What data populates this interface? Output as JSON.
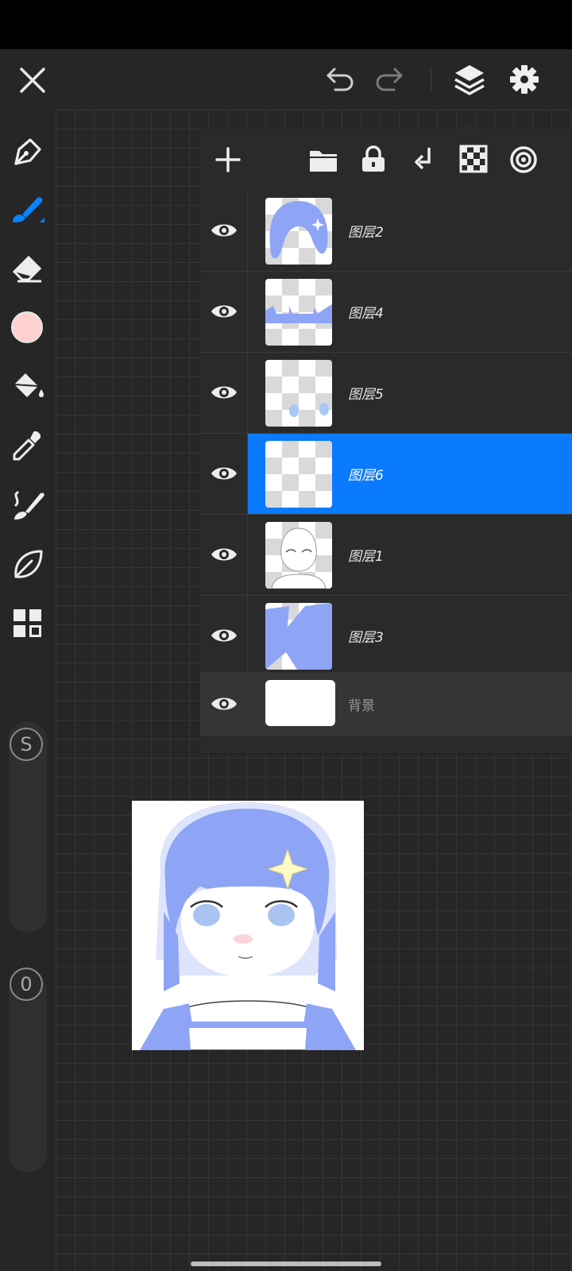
{
  "top_bar": {
    "icons": [
      "close-icon",
      "undo-icon",
      "redo-icon",
      "layers-icon",
      "settings-icon"
    ]
  },
  "toolbar": {
    "tools": [
      "pen-tool-icon",
      "brush-tool-icon",
      "eraser-tool-icon",
      "color-swatch",
      "fill-bucket-icon",
      "eyedropper-icon",
      "smudge-brush-icon",
      "leaf-icon",
      "grid-apps-icon"
    ],
    "current_color": "#ffd0d0",
    "active_color": "#0a84ff",
    "size_label": "S",
    "opacity_label": "0"
  },
  "layer_panel": {
    "toolbar_icons": [
      "add-layer-icon",
      "folder-icon",
      "lock-icon",
      "merge-down-icon",
      "checker-icon",
      "spiral-icon"
    ],
    "layers": [
      {
        "name": "图层2",
        "selected": false
      },
      {
        "name": "图层4",
        "selected": false
      },
      {
        "name": "图层5",
        "selected": false
      },
      {
        "name": "图层6",
        "selected": true
      },
      {
        "name": "图层1",
        "selected": false
      },
      {
        "name": "图层3",
        "selected": false
      }
    ],
    "background": {
      "name": "背景"
    },
    "accent": "#0a7aff"
  },
  "colors": {
    "hair_blue": "#8ea5f5",
    "panel_bg": "#2a2a2a"
  }
}
